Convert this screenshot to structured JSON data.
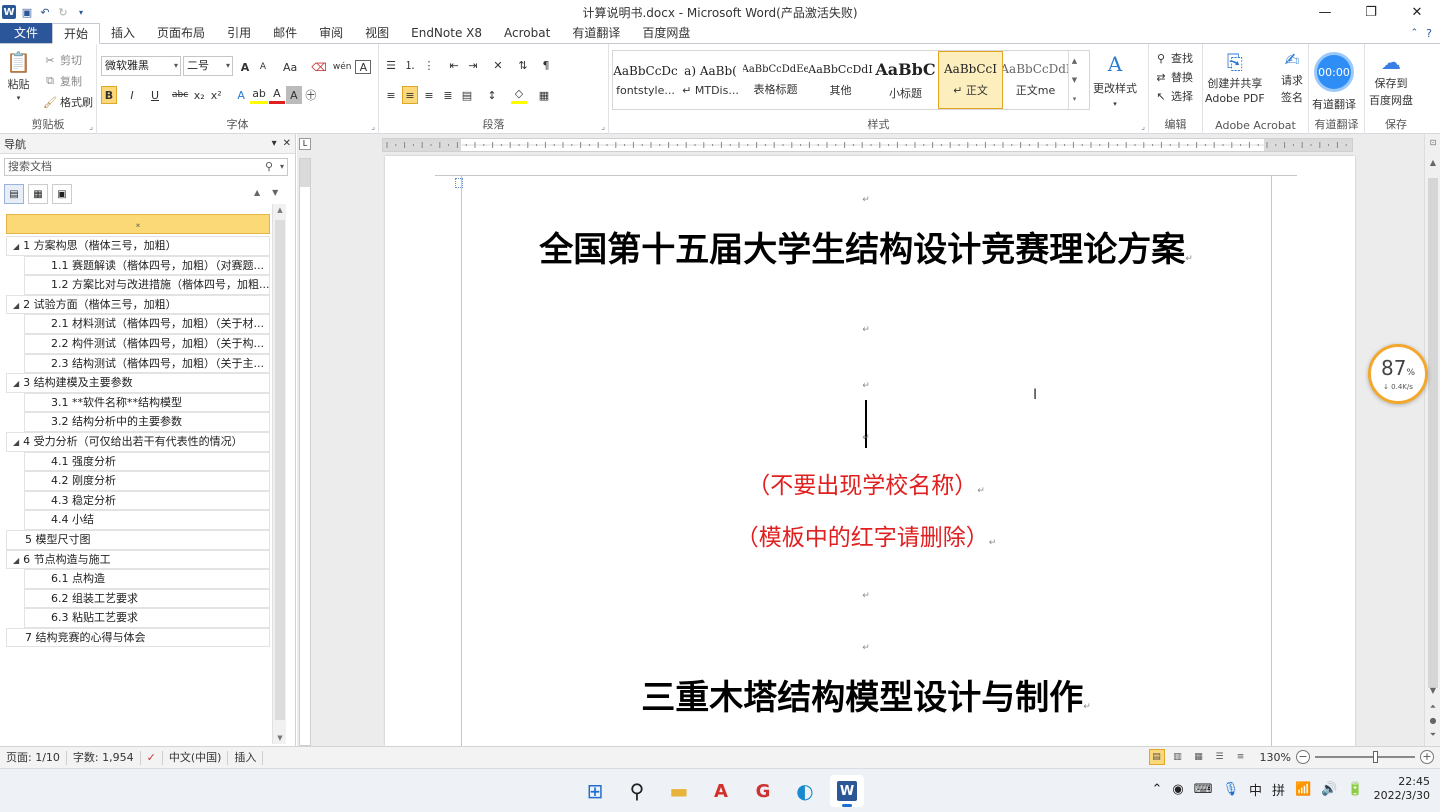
{
  "window": {
    "title": "计算说明书.docx - Microsoft Word(产品激活失败)",
    "minimize_icon": "minimize-icon",
    "maximize_icon": "restore-icon",
    "close_icon": "close-icon"
  },
  "tabs": [
    "文件",
    "开始",
    "插入",
    "页面布局",
    "引用",
    "邮件",
    "审阅",
    "视图",
    "EndNote X8",
    "Acrobat",
    "有道翻译",
    "百度网盘"
  ],
  "ribbon": {
    "clipboard": {
      "paste": "粘贴",
      "cut": "剪切",
      "copy": "复制",
      "format_painter": "格式刷",
      "label": "剪贴板"
    },
    "font": {
      "font_name": "微软雅黑",
      "font_size": "二号",
      "label": "字体",
      "bold": "B",
      "italic": "I",
      "underline": "U",
      "strike": "abc",
      "sub": "x₂",
      "sup": "x²",
      "grow": "A",
      "shrink": "A",
      "case": "Aa",
      "clear": "A",
      "phonetic": "wén",
      "border": "A"
    },
    "paragraph": {
      "label": "段落"
    },
    "styles": {
      "label": "样式",
      "items": [
        {
          "sample": "AaBbCcDc",
          "name": "fontstyle..."
        },
        {
          "sample": "a)  AaBb(",
          "name": "↵ MTDis..."
        },
        {
          "sample": "AaBbCcDdEe",
          "name": "表格标题"
        },
        {
          "sample": "AaBbCcDdI",
          "name": "其他"
        },
        {
          "sample": "AaBbC",
          "name": "小标题"
        },
        {
          "sample": "AaBbCcI",
          "name": "↵ 正文"
        },
        {
          "sample": "AaBbCcDdI",
          "name": "正文me"
        }
      ],
      "change_styles": "更改样式"
    },
    "editing": {
      "find": "查找",
      "replace": "替换",
      "select": "选择",
      "label": "编辑"
    },
    "adobe": {
      "create_share": "创建并共享",
      "adobe_pdf": "Adobe PDF",
      "request_sign": "请求",
      "sign": "签名",
      "label": "Adobe Acrobat"
    },
    "youdao": {
      "timer": "00:00",
      "translate": "有道翻译",
      "label": "有道翻译"
    },
    "baidu": {
      "save_to": "保存到",
      "netdisk": "百度网盘",
      "label": "保存"
    }
  },
  "nav": {
    "title": "导航",
    "search_placeholder": "搜索文档",
    "items": [
      {
        "level": 1,
        "text": "1 方案构思（楷体三号，加粗）",
        "expanded": true
      },
      {
        "level": 2,
        "text": "1.1 赛题解读（楷体四号，加粗）（对赛题..."
      },
      {
        "level": 2,
        "text": "1.2 方案比对与改进措施（楷体四号，加粗..."
      },
      {
        "level": 1,
        "text": "2 试验方面（楷体三号，加粗）",
        "expanded": true
      },
      {
        "level": 2,
        "text": "2.1 材料测试（楷体四号，加粗）（关于材..."
      },
      {
        "level": 2,
        "text": "2.2 构件测试（楷体四号，加粗）（关于构..."
      },
      {
        "level": 2,
        "text": "2.3 结构测试（楷体四号，加粗）（关于主..."
      },
      {
        "level": 1,
        "text": "3 结构建模及主要参数",
        "expanded": true
      },
      {
        "level": 2,
        "text": "3.1 **软件名称**结构模型"
      },
      {
        "level": 2,
        "text": "3.2 结构分析中的主要参数"
      },
      {
        "level": 1,
        "text": "4 受力分析（可仅给出若干有代表性的情况）",
        "expanded": true
      },
      {
        "level": 2,
        "text": "4.1 强度分析"
      },
      {
        "level": 2,
        "text": "4.2 刚度分析"
      },
      {
        "level": 2,
        "text": "4.3 稳定分析"
      },
      {
        "level": 2,
        "text": "4.4 小结"
      },
      {
        "level": 1,
        "text": "5 模型尺寸图",
        "expanded": false,
        "leaf": true
      },
      {
        "level": 1,
        "text": "6 节点构造与施工",
        "expanded": true
      },
      {
        "level": 2,
        "text": "6.1 点构造"
      },
      {
        "level": 2,
        "text": "6.2 组装工艺要求"
      },
      {
        "level": 2,
        "text": "6.3 粘贴工艺要求"
      },
      {
        "level": 1,
        "text": "7 结构竞赛的心得与体会",
        "expanded": false,
        "leaf": true
      }
    ]
  },
  "document": {
    "title": "全国第十五届大学生结构设计竞赛理论方案",
    "note1": "（不要出现学校名称）",
    "note2": "（模板中的红字请删除）",
    "subtitle": "三重木塔结构模型设计与制作",
    "para_mark": "↵"
  },
  "speed_widget": {
    "percent": "87",
    "percent_sign": "%",
    "rate": "↓ 0.4K/s"
  },
  "status": {
    "page": "页面: 1/10",
    "words": "字数: 1,954",
    "language": "中文(中国)",
    "insert_mode": "插入",
    "zoom": "130%"
  },
  "taskbar": {
    "time": "22:45",
    "date": "2022/3/30",
    "ime_zh": "中",
    "ime_pinyin": "拼"
  },
  "colors": {
    "accent": "#2b579a",
    "red_text": "#e02020",
    "highlight": "#fcd87a"
  }
}
